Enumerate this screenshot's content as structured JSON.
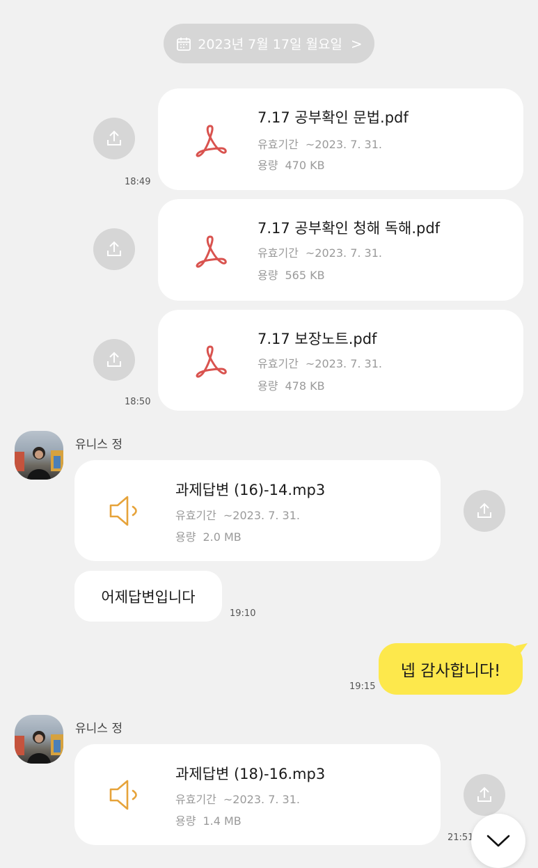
{
  "date_pill": {
    "text": "2023년 7월 17일 월요일",
    "chevron": ">"
  },
  "files_sent": [
    {
      "name": "7.17 공부확인 문법.pdf",
      "expiry_label": "유효기간",
      "expiry_value": "~2023. 7. 31.",
      "size_label": "용량",
      "size_value": "470 KB",
      "time": "18:49"
    },
    {
      "name": "7.17 공부확인 청해 독해.pdf",
      "expiry_label": "유효기간",
      "expiry_value": "~2023. 7. 31.",
      "size_label": "용량",
      "size_value": "565 KB",
      "time": ""
    },
    {
      "name": "7.17 보장노트.pdf",
      "expiry_label": "유효기간",
      "expiry_value": "~2023. 7. 31.",
      "size_label": "용량",
      "size_value": "478 KB",
      "time": "18:50"
    }
  ],
  "message_group_1": {
    "sender": "유니스 정",
    "file": {
      "name": "과제답변 (16)-14.mp3",
      "expiry_label": "유효기간",
      "expiry_value": "~2023. 7. 31.",
      "size_label": "용량",
      "size_value": "2.0 MB"
    },
    "text": "어제답변입니다",
    "time": "19:10"
  },
  "my_message": {
    "text": "넵 감사합니다!",
    "time": "19:15"
  },
  "message_group_2": {
    "sender": "유니스 정",
    "file": {
      "name": "과제답변 (18)-16.mp3",
      "expiry_label": "유효기간",
      "expiry_value": "~2023. 7. 31.",
      "size_label": "용량",
      "size_value": "1.4 MB"
    },
    "time": "21:51"
  },
  "colors": {
    "background": "#f1f1f1",
    "my_bubble": "#fde84c",
    "pdf_icon": "#d9534f",
    "audio_icon": "#e6a33a",
    "share_button": "#d6d6d6"
  },
  "icons": {
    "calendar": "calendar-icon",
    "pdf": "pdf-icon",
    "audio": "speaker-icon",
    "share": "share-icon",
    "scroll_down": "chevron-down-icon"
  }
}
